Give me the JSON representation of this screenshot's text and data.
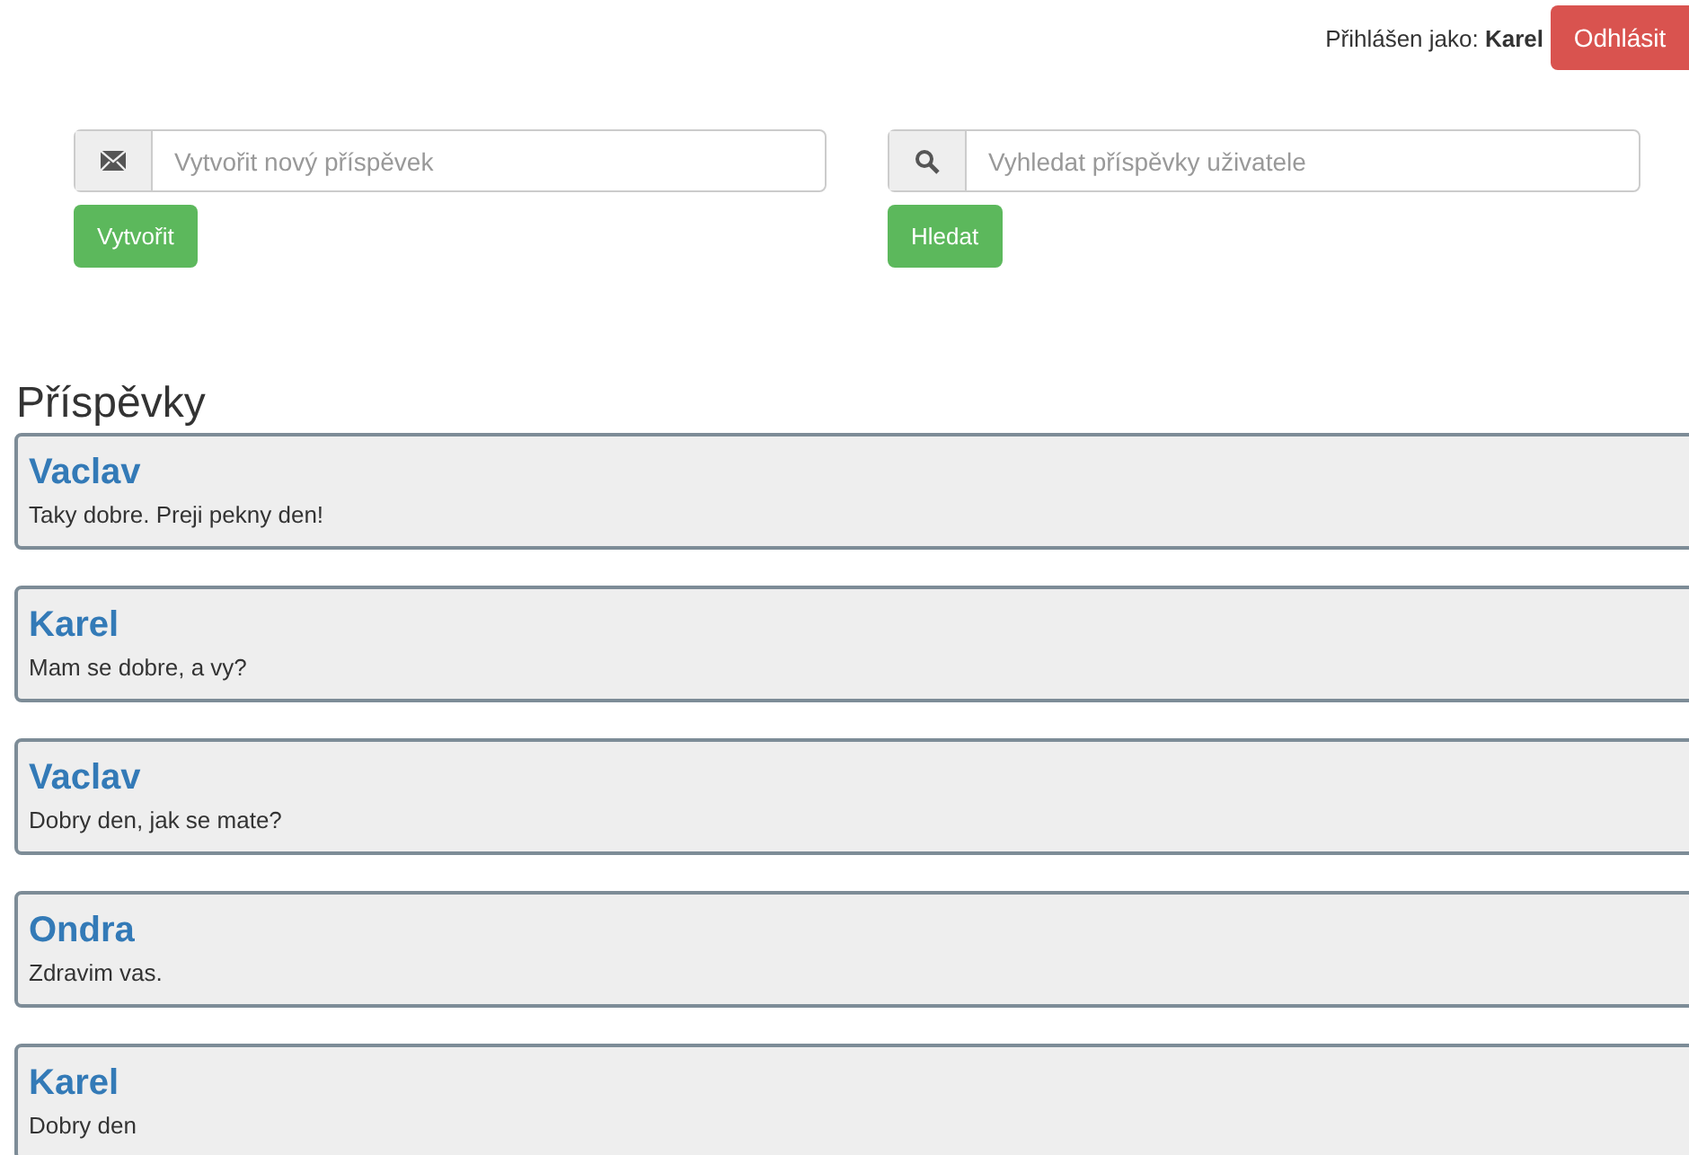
{
  "header": {
    "login_text": "Přihlášen jako: **Karel**",
    "logout_button": "Odhlásit"
  },
  "create_form": {
    "placeholder": "Vytvořit nový příspěvek",
    "button": "Vytvořit"
  },
  "search_form": {
    "placeholder": "Vyhledat příspěvky uživatele",
    "button": "Hledat"
  },
  "posts_heading": "Příspěvky",
  "posts": [
    {
      "author": "Vaclav",
      "text": "Taky dobre. Preji pekny den!"
    },
    {
      "author": "Karel",
      "text": "Mam se dobre, a vy?"
    },
    {
      "author": "Vaclav",
      "text": "Dobry den, jak se mate?"
    },
    {
      "author": "Ondra",
      "text": "Zdravim vas."
    },
    {
      "author": "Karel",
      "text": "Dobry den"
    }
  ]
}
